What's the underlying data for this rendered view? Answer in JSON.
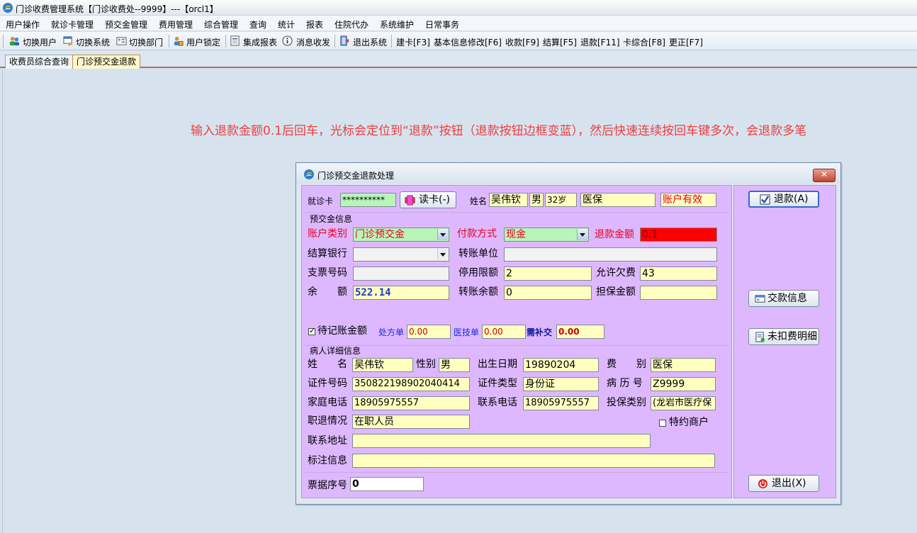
{
  "window": {
    "title": "门诊收费管理系统【门诊收费处--9999】---【orcl1】"
  },
  "menu": [
    "用户操作",
    "就诊卡管理",
    "预交金管理",
    "费用管理",
    "综合管理",
    "查询",
    "统计",
    "报表",
    "住院代办",
    "系统维护",
    "日常事务"
  ],
  "toolbar": {
    "switch_user": "切换用户",
    "switch_system": "切换系统",
    "switch_dept": "切换部门",
    "lock_user": "用户锁定",
    "integrated_report": "集成报表",
    "messages": "消息收发",
    "exit_system": "退出系统",
    "create_card": "建卡[F3]",
    "modify_info": "基本信息修改[F6]",
    "charge": "收款[F9]",
    "settle": "结算[F5]",
    "refund": "退款[F11]",
    "card_summary": "卡综合[F8]",
    "correct": "更正[F7]"
  },
  "tabs": [
    "收费员综合查询",
    "门诊预交金退款"
  ],
  "notice": "输入退款金额0.1后回车，光标会定位到“退款”按钮（退款按钮边框变蓝），然后快速连续按回车键多次，会退款多笔",
  "dialog": {
    "title": "门诊预交金退款处理",
    "close_label": "✕",
    "card": {
      "label": "就诊卡",
      "value": "**********",
      "read_button": "读卡(-)",
      "name_label": "姓名",
      "name": "吴伟钦",
      "sex": "男",
      "age": "32岁",
      "insurance": "医保",
      "status": "账户有效"
    },
    "deposit": {
      "group_title": "预交金信息",
      "account_type_label": "账户类别",
      "account_type": "门诊预交金",
      "pay_method_label": "付款方式",
      "pay_method": "现金",
      "refund_amount_label": "退款金额",
      "refund_amount": "0.1",
      "bank_label": "结算银行",
      "bank": "",
      "transfer_unit_label": "转账单位",
      "transfer_unit": "",
      "check_no_label": "支票号码",
      "check_no": "",
      "stop_limit_label": "停用限额",
      "stop_limit": "2",
      "allow_owe_label": "允许欠费",
      "allow_owe": "43",
      "balance_label": "余　　额",
      "balance": "522.14",
      "transfer_balance_label": "转账余额",
      "transfer_balance": "0",
      "guarantee_label": "担保金额",
      "guarantee": "",
      "pending_label": "待记账金额",
      "prescription_label": "处方单",
      "prescription": "0.00",
      "tech_label": "医技单",
      "tech": "0.00",
      "need_pay_label": "需补交",
      "need_pay": "0.00"
    },
    "patient": {
      "group_title": "病人详细信息",
      "name_label": "姓　　名",
      "name": "吴伟钦",
      "sex_label": "性别",
      "sex": "男",
      "birth_label": "出生日期",
      "birth": "19890204",
      "fee_type_label": "费　　别",
      "fee_type": "医保",
      "id_no_label": "证件号码",
      "id_no": "350822198902040414",
      "id_type_label": "证件类型",
      "id_type": "身份证",
      "record_no_label": "病 历 号",
      "record_no": "Z9999",
      "home_phone_label": "家庭电话",
      "home_phone": "18905975557",
      "contact_phone_label": "联系电话",
      "contact_phone": "18905975557",
      "insure_type_label": "投保类别",
      "insure_type": "(龙岩市医疗保",
      "job_label": "职退情况",
      "job": "在职人员",
      "vip_label": "特约商户",
      "address_label": "联系地址",
      "address": "",
      "remark_label": "标注信息",
      "remark": ""
    },
    "receipt": {
      "label": "票据序号",
      "value": "0"
    },
    "buttons": {
      "refund": "退款(A)",
      "payment_info": "交款信息",
      "unpaid_detail": "未扣费明细",
      "exit": "退出(X)"
    }
  }
}
